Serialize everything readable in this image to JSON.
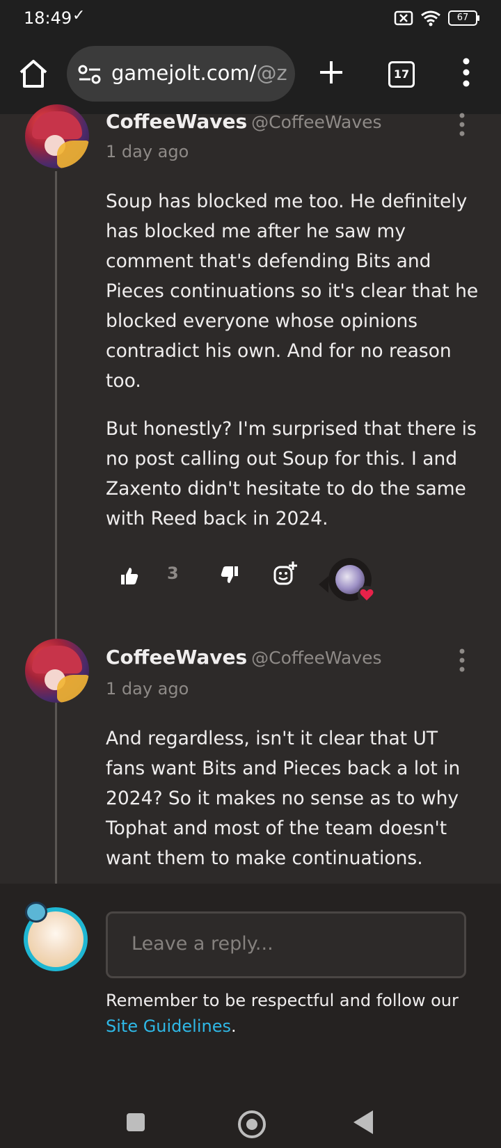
{
  "status_bar": {
    "time": "18:49",
    "battery": "67"
  },
  "browser": {
    "url_main": "gamejolt.com/",
    "url_dim": "@z",
    "tab_count": "17"
  },
  "comments": [
    {
      "author": "CoffeeWaves",
      "handle": "@CoffeeWaves",
      "time": "1 day ago",
      "paragraphs": [
        "Soup has blocked me too. He definitely has blocked me after he saw my comment that's defending Bits and Pieces continuations so it's clear that he blocked everyone whose opinions contradict his own. And for no reason too.",
        "But honestly? I'm surprised that there is no post calling out Soup for this. I and Zaxento didn't hesitate to do the same with Reed back in 2024."
      ],
      "likes": "3"
    },
    {
      "author": "CoffeeWaves",
      "handle": "@CoffeeWaves",
      "time": "1 day ago",
      "paragraphs": [
        "And regardless, isn't it clear that UT fans want Bits and Pieces back a lot in 2024? So it makes no sense as to why Tophat and most of the team doesn't want them to make continuations."
      ]
    }
  ],
  "reply": {
    "placeholder": "Leave a reply...",
    "notice": "Remember to be respectful and follow our ",
    "link": "Site Guidelines",
    "notice_end": "."
  },
  "colors": {
    "background": "#2d2a29",
    "link": "#2fb8e6",
    "heart": "#e8224a"
  }
}
